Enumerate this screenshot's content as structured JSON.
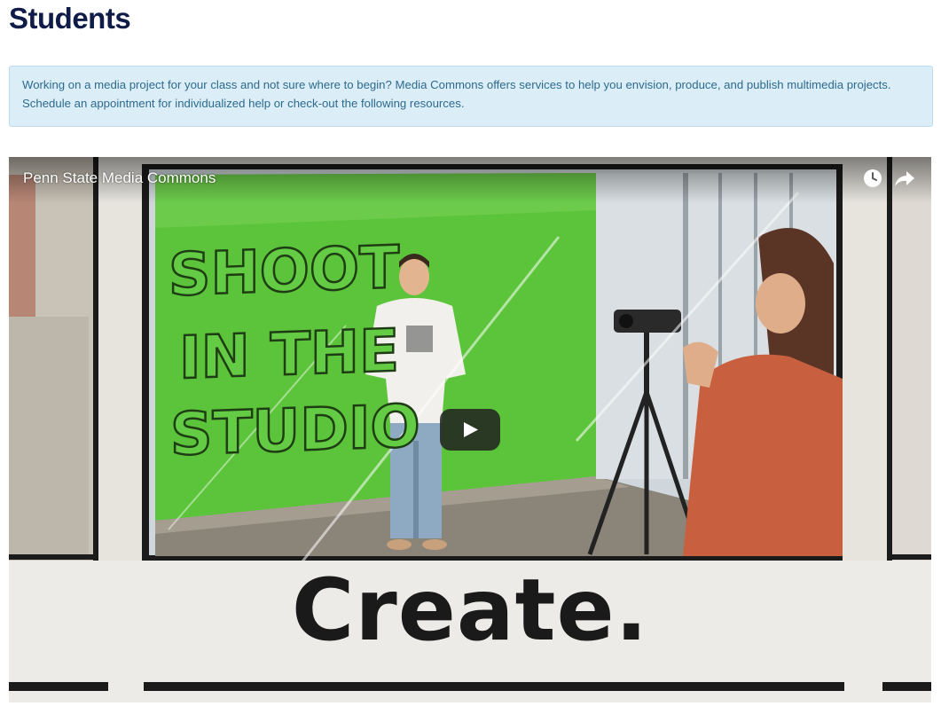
{
  "page": {
    "title": "Students"
  },
  "info_box": {
    "line1": "Working on a media project for your class and not sure where to begin? Media Commons offers services to help you envision, produce, and publish multimedia projects.",
    "line2": "Schedule an appointment for individualized help or check-out the following resources."
  },
  "video": {
    "title": "Penn State Media Commons",
    "studio_sign": [
      "SHOOT",
      "IN THE",
      "STUDIO"
    ],
    "caption": "Create.",
    "controls": {
      "watch_later_icon": "clock-icon",
      "share_icon": "share-arrow-icon",
      "play_icon": "play-icon"
    }
  },
  "colors": {
    "title": "#0f1c47",
    "info_background": "#dbeef8",
    "info_text": "#2d6a8d",
    "green_screen": "#5cc43a"
  }
}
